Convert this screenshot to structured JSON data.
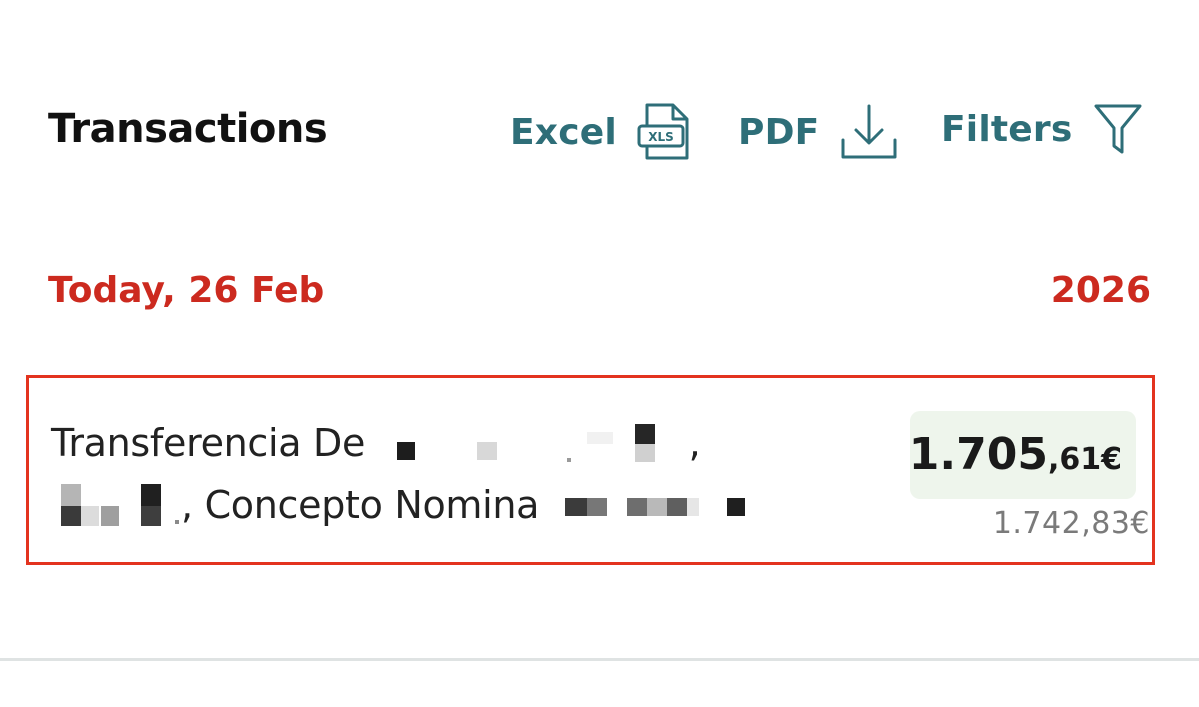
{
  "header": {
    "title": "Transactions",
    "actions": [
      {
        "label": "Excel",
        "icon": "xls-file-icon"
      },
      {
        "label": "PDF",
        "icon": "download-icon"
      },
      {
        "label": "Filters",
        "icon": "filter-icon"
      }
    ]
  },
  "date_group": {
    "date_label": "Today, 26 Feb",
    "year": "2026"
  },
  "transaction": {
    "description_line1_prefix": "Transferencia De",
    "description_line1_suffix": ",",
    "description_line2_sep": ",",
    "description_line2_text": "Concepto Nomina",
    "amount_integer": "1.705",
    "amount_decimal": ",61€",
    "balance": "1.742,83€",
    "xls_icon_text": "XLS"
  },
  "colors": {
    "accent_teal": "#2e6e78",
    "date_red": "#cc2a1f",
    "highlight_border": "#e3331f",
    "amount_bg": "#eef5ec"
  }
}
